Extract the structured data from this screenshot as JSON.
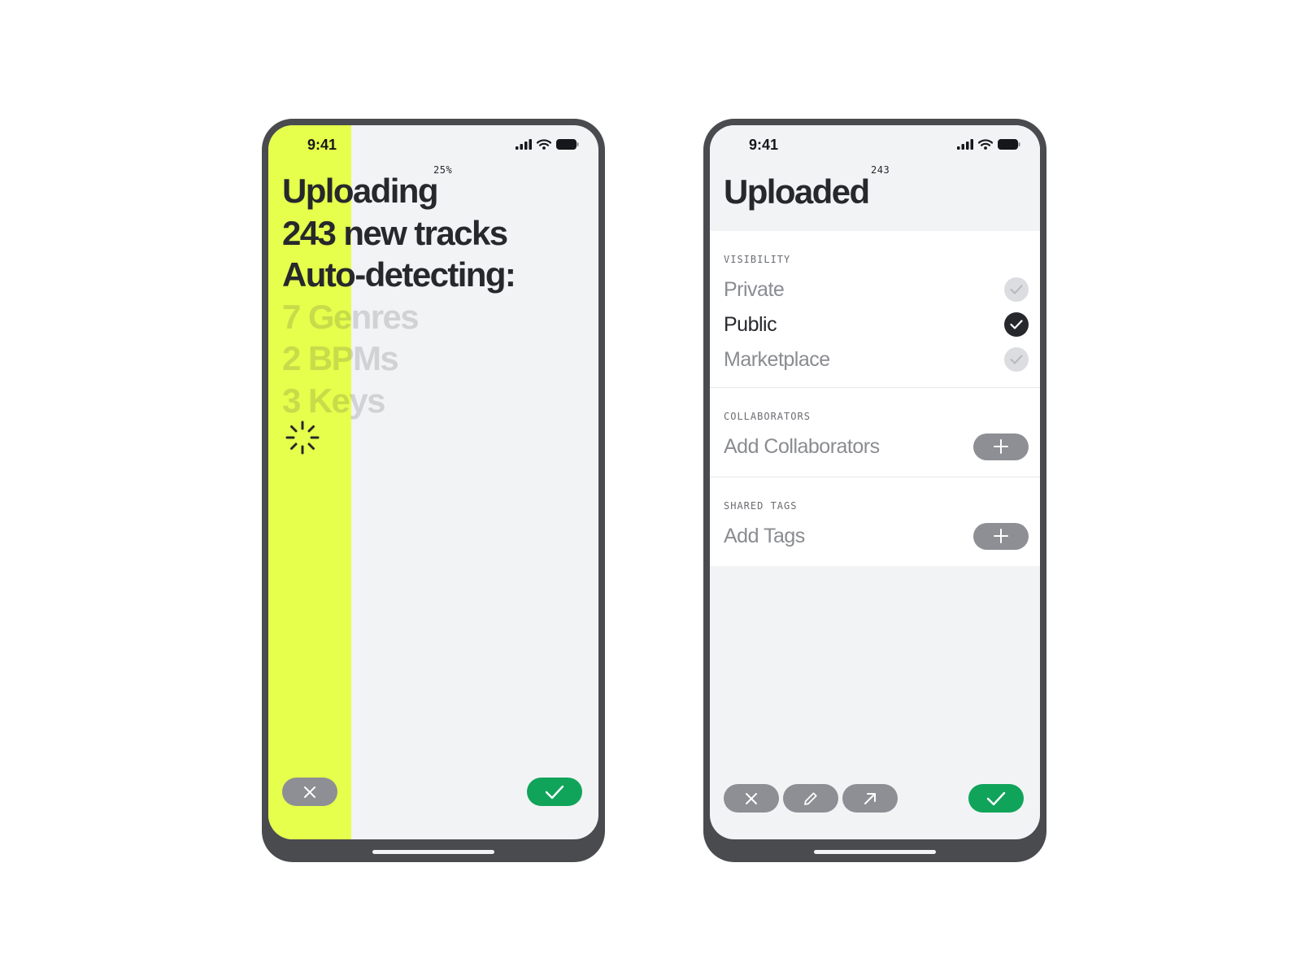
{
  "status_bar": {
    "time": "9:41"
  },
  "upload_screen": {
    "progress_label": "25%",
    "progress": 0.25,
    "lines": [
      "Uploading",
      "243 new tracks",
      "Auto-detecting:"
    ],
    "detecting": [
      "7 Genres",
      "2 BPMs",
      "3 Keys"
    ],
    "accent_color": "#e5ff4c"
  },
  "uploaded_screen": {
    "title": "Uploaded",
    "count": "243",
    "visibility": {
      "label": "VISIBILITY",
      "options": [
        {
          "label": "Private",
          "selected": false
        },
        {
          "label": "Public",
          "selected": true
        },
        {
          "label": "Marketplace",
          "selected": false
        }
      ]
    },
    "collaborators": {
      "label": "COLLABORATORS",
      "action": "Add Collaborators"
    },
    "shared_tags": {
      "label": "SHARED TAGS",
      "action": "Add Tags"
    }
  },
  "icons": {
    "cancel": "x-icon",
    "confirm": "check-icon",
    "edit": "pencil-icon",
    "share": "arrow-up-right-icon",
    "add": "plus-icon"
  },
  "colors": {
    "confirm": "#10a45a",
    "neutral": "#8d8f94",
    "dark": "#26282c"
  }
}
